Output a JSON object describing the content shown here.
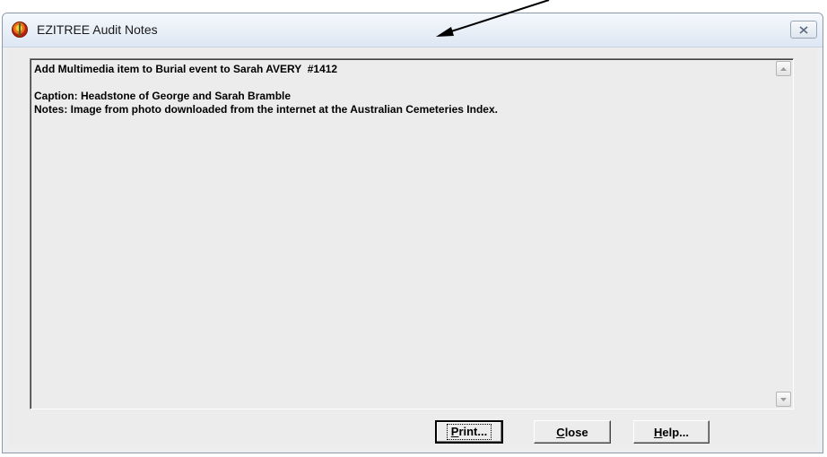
{
  "window": {
    "title": "EZITREE Audit Notes"
  },
  "notes": {
    "lines": [
      "Add Multimedia item to Burial event to Sarah AVERY  #1412",
      "",
      "Caption: Headstone of George and Sarah Bramble",
      "Notes: Image from photo downloaded from the internet at the Australian Cemeteries Index."
    ]
  },
  "buttons": {
    "print": {
      "mnemonic": "P",
      "rest": "rint..."
    },
    "close": {
      "mnemonic": "C",
      "rest": "lose"
    },
    "help": {
      "mnemonic": "H",
      "rest": "elp..."
    }
  },
  "icons": {
    "app": "ezitree-app-icon",
    "close": "close-icon",
    "scroll_up": "scroll-up-arrow-icon",
    "scroll_down": "scroll-down-arrow-icon",
    "annotation": "arrow-annotation"
  }
}
